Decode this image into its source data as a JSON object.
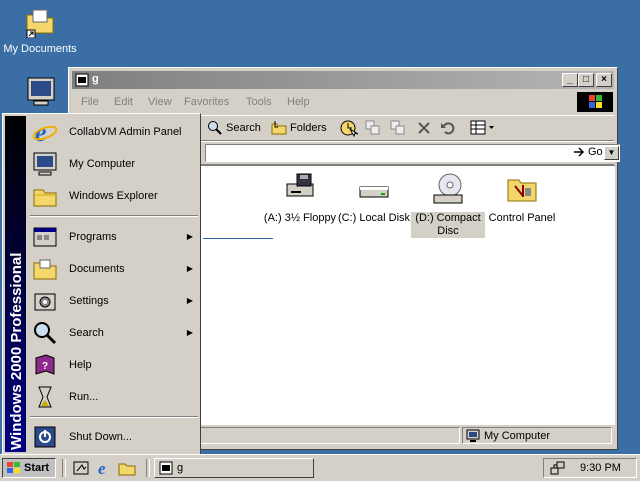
{
  "desktop": {
    "icons": [
      {
        "label": "My Documents"
      },
      {
        "label": ""
      }
    ]
  },
  "window": {
    "title": "g",
    "menu": [
      "File",
      "Edit",
      "View",
      "Favorites",
      "Tools",
      "Help"
    ],
    "toolbar": {
      "search": "Search",
      "folders": "Folders"
    },
    "address": {
      "value": "",
      "go": "Go"
    },
    "drives": [
      {
        "label": "(A:) 3½ Floppy"
      },
      {
        "label": "(C:) Local Disk"
      },
      {
        "label": "(D:) Compact Disc"
      },
      {
        "label": "Control Panel"
      }
    ],
    "status": {
      "location": "My Computer"
    }
  },
  "startmenu": {
    "band_text": "Windows 2000 Professional",
    "items": [
      {
        "label": "CollabVM Admin Panel"
      },
      {
        "label": "My Computer"
      },
      {
        "label": "Windows Explorer"
      },
      {
        "label": "Programs"
      },
      {
        "label": "Documents"
      },
      {
        "label": "Settings"
      },
      {
        "label": "Search"
      },
      {
        "label": "Help"
      },
      {
        "label": "Run..."
      },
      {
        "label": "Shut Down..."
      }
    ]
  },
  "taskbar": {
    "start": "Start",
    "task": "g",
    "clock": "9:30 PM"
  },
  "colors": {
    "desktop": "#3a6ea5",
    "face": "#d4d0c8",
    "band": "#000080"
  }
}
